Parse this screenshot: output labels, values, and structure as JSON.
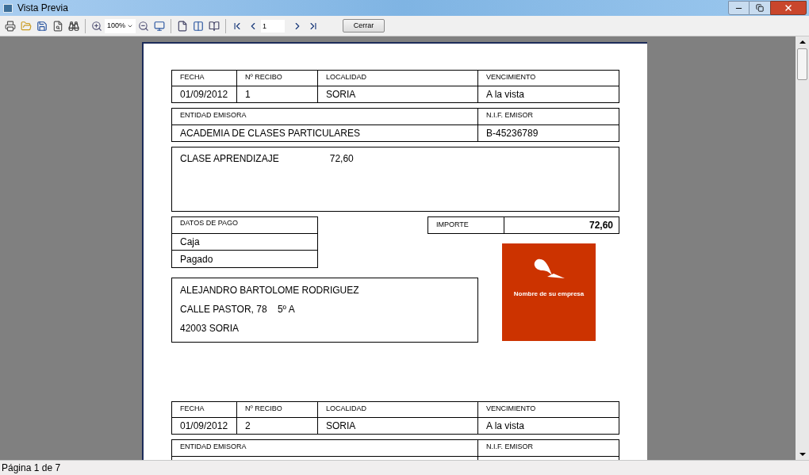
{
  "window": {
    "title": "Vista Previa"
  },
  "toolbar": {
    "zoom": "100%",
    "page": "1",
    "close_button": "Cerrar"
  },
  "receipts": [
    {
      "header": [
        {
          "label": "FECHA",
          "value": "01/09/2012"
        },
        {
          "label": "Nº RECIBO",
          "value": "1"
        },
        {
          "label": "LOCALIDAD",
          "value": "SORIA"
        },
        {
          "label": "VENCIMIENTO",
          "value": "A la vista"
        }
      ],
      "issuer": [
        {
          "label": "ENTIDAD EMISORA",
          "value": "ACADEMIA DE CLASES PARTICULARES"
        },
        {
          "label": "N.I.F. EMISOR",
          "value": "B-45236789"
        }
      ],
      "concept": {
        "description": "CLASE APRENDIZAJE",
        "amount": "72,60"
      },
      "payment": {
        "label": "DATOS DE PAGO",
        "lines": [
          "Caja",
          "Pagado"
        ]
      },
      "total": {
        "label": "IMPORTE",
        "value": "72,60"
      },
      "address": [
        "ALEJANDRO BARTOLOME RODRIGUEZ",
        "CALLE PASTOR, 78    5º A",
        "42003 SORIA"
      ],
      "logo_text": "Nombre de su empresa"
    },
    {
      "header": [
        {
          "label": "FECHA",
          "value": "01/09/2012"
        },
        {
          "label": "Nº RECIBO",
          "value": "2"
        },
        {
          "label": "LOCALIDAD",
          "value": "SORIA"
        },
        {
          "label": "VENCIMIENTO",
          "value": "A la vista"
        }
      ],
      "issuer": [
        {
          "label": "ENTIDAD EMISORA"
        },
        {
          "label": "N.I.F. EMISOR"
        }
      ]
    }
  ],
  "status_bar": "Página 1 de 7"
}
